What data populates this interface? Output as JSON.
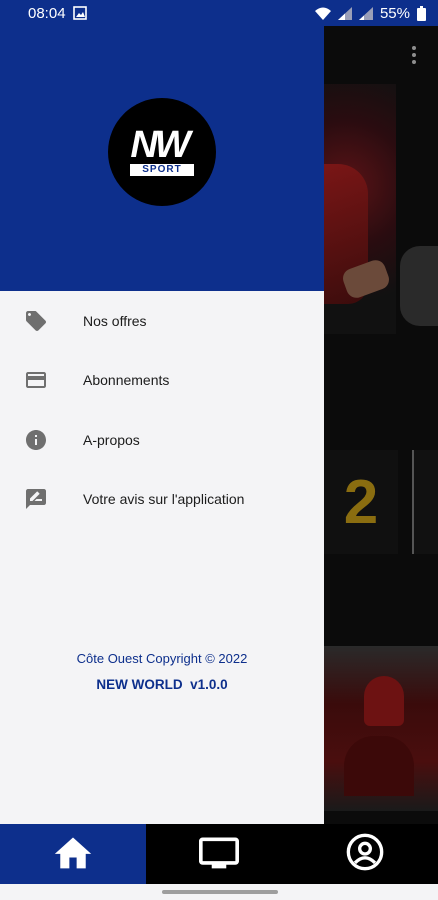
{
  "status_bar": {
    "time": "08:04",
    "battery": "55%",
    "icons": [
      "image-icon",
      "wifi-icon",
      "signal-icon",
      "signal-icon",
      "battery-icon"
    ]
  },
  "drawer": {
    "logo": {
      "mark": "NW",
      "sub": "SPORT"
    },
    "menu": [
      {
        "icon": "tag-icon",
        "label": "Nos offres"
      },
      {
        "icon": "credit-card-icon",
        "label": "Abonnements"
      },
      {
        "icon": "info-icon",
        "label": "A-propos"
      },
      {
        "icon": "feedback-icon",
        "label": "Votre avis sur l'application"
      }
    ],
    "copyright": "Côte Ouest Copyright © 2022",
    "version": "NEW WORLD  v1.0.0"
  },
  "background": {
    "card_numeral": "2"
  },
  "bottom_nav": {
    "items": [
      {
        "icon": "home-icon",
        "active": true
      },
      {
        "icon": "tv-icon",
        "active": false
      },
      {
        "icon": "account-icon",
        "active": false
      }
    ]
  },
  "colors": {
    "brand_blue": "#0d2f8c",
    "drawer_bg": "#f4f4f6",
    "icon_grey": "#6f6f6f"
  }
}
